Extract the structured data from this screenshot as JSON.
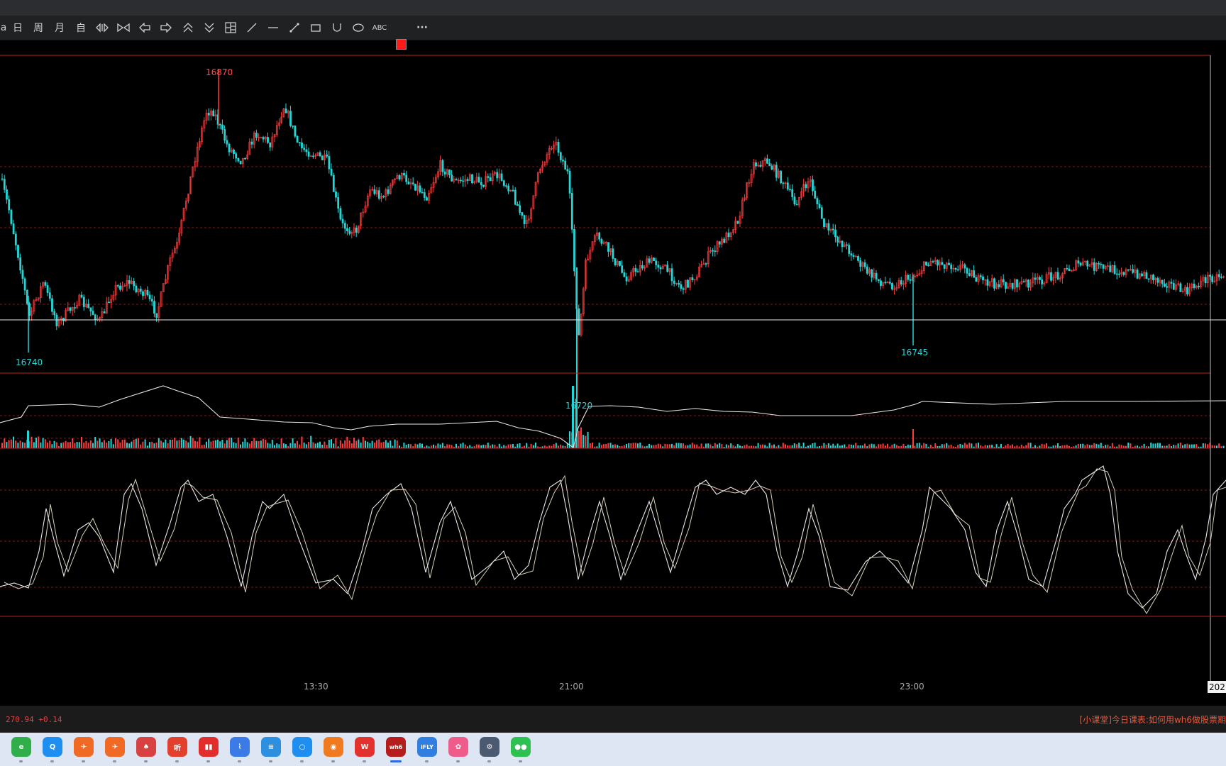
{
  "toolbar": {
    "items": [
      {
        "name": "tb-partial",
        "label": "a"
      },
      {
        "name": "tb-day",
        "label": "日"
      },
      {
        "name": "tb-week",
        "label": "周"
      },
      {
        "name": "tb-month",
        "label": "月"
      },
      {
        "name": "tb-custom",
        "label": "自"
      },
      {
        "name": "tb-zoom-in-icon",
        "icon": "zoom-in"
      },
      {
        "name": "tb-zoom-out-icon",
        "icon": "zoom-out"
      },
      {
        "name": "tb-left-arrow-icon",
        "icon": "arrow-left"
      },
      {
        "name": "tb-right-arrow-icon",
        "icon": "arrow-right"
      },
      {
        "name": "tb-double-up-icon",
        "icon": "double-up"
      },
      {
        "name": "tb-double-down-icon",
        "icon": "double-down"
      },
      {
        "name": "tb-layout-icon",
        "icon": "layout"
      },
      {
        "name": "tb-line-icon",
        "icon": "diagonal-line"
      },
      {
        "name": "tb-hline-icon",
        "icon": "horizontal-line"
      },
      {
        "name": "tb-ray-icon",
        "icon": "ray"
      },
      {
        "name": "tb-rect-icon",
        "icon": "rectangle"
      },
      {
        "name": "tb-arc-icon",
        "icon": "arc"
      },
      {
        "name": "tb-ellipse-icon",
        "icon": "ellipse"
      },
      {
        "name": "tb-text-icon",
        "label": "ABC"
      },
      {
        "name": "tb-color-swatch",
        "color": "#ff1a1a"
      },
      {
        "name": "tb-more-icon",
        "label": "···"
      }
    ]
  },
  "chart": {
    "annotations": {
      "high": "16870",
      "low_left": "16740",
      "low_mid": "16720",
      "low_right": "16745"
    },
    "time_labels": [
      "13:30",
      "21:00",
      "23:00",
      "202"
    ],
    "colors": {
      "up": "#ff3b3b",
      "down": "#24d6d6",
      "border": "#b3251f",
      "grid": "#7a1d1d",
      "line": "#e8e8e8",
      "cursor": "#bfbfbf"
    }
  },
  "status": {
    "left": "270.94 +0.14",
    "right": "[小课堂]今日课表:如何用wh6做股票期"
  },
  "taskbar": {
    "apps": [
      {
        "name": "app-360-browser-icon",
        "label": "e",
        "color": "#2fae4a"
      },
      {
        "name": "app-search-icon",
        "label": "Q",
        "color": "#1e8ef0"
      },
      {
        "name": "app-paper-plane-icon",
        "label": "✈",
        "color": "#f06a25"
      },
      {
        "name": "app-paper-plane2-icon",
        "label": "✈",
        "color": "#f06a25"
      },
      {
        "name": "app-cards-icon",
        "label": "♠",
        "color": "#d84141"
      },
      {
        "name": "app-listen-icon",
        "label": "听",
        "color": "#e2402d"
      },
      {
        "name": "app-stock-icon",
        "label": "▮▮",
        "color": "#e22d2d"
      },
      {
        "name": "app-chart-icon",
        "label": "⌇",
        "color": "#3c7be6"
      },
      {
        "name": "app-notes-icon",
        "label": "≡",
        "color": "#2d8fe0"
      },
      {
        "name": "app-cloud-icon",
        "label": "○",
        "color": "#1e8ef0"
      },
      {
        "name": "app-mask-icon",
        "label": "◉",
        "color": "#f07a20"
      },
      {
        "name": "app-wps-icon",
        "label": "W",
        "color": "#e2322d"
      },
      {
        "name": "app-wh6-icon",
        "label": "wh6",
        "color": "#b51d1d"
      },
      {
        "name": "app-ifly-icon",
        "label": "iFLY",
        "color": "#2f7ee0"
      },
      {
        "name": "app-camera-icon",
        "label": "✿",
        "color": "#ef5b8a"
      },
      {
        "name": "app-settings-icon",
        "label": "⚙",
        "color": "#4b5a70"
      },
      {
        "name": "app-wechat-icon",
        "label": "●●",
        "color": "#2ec152"
      }
    ]
  }
}
